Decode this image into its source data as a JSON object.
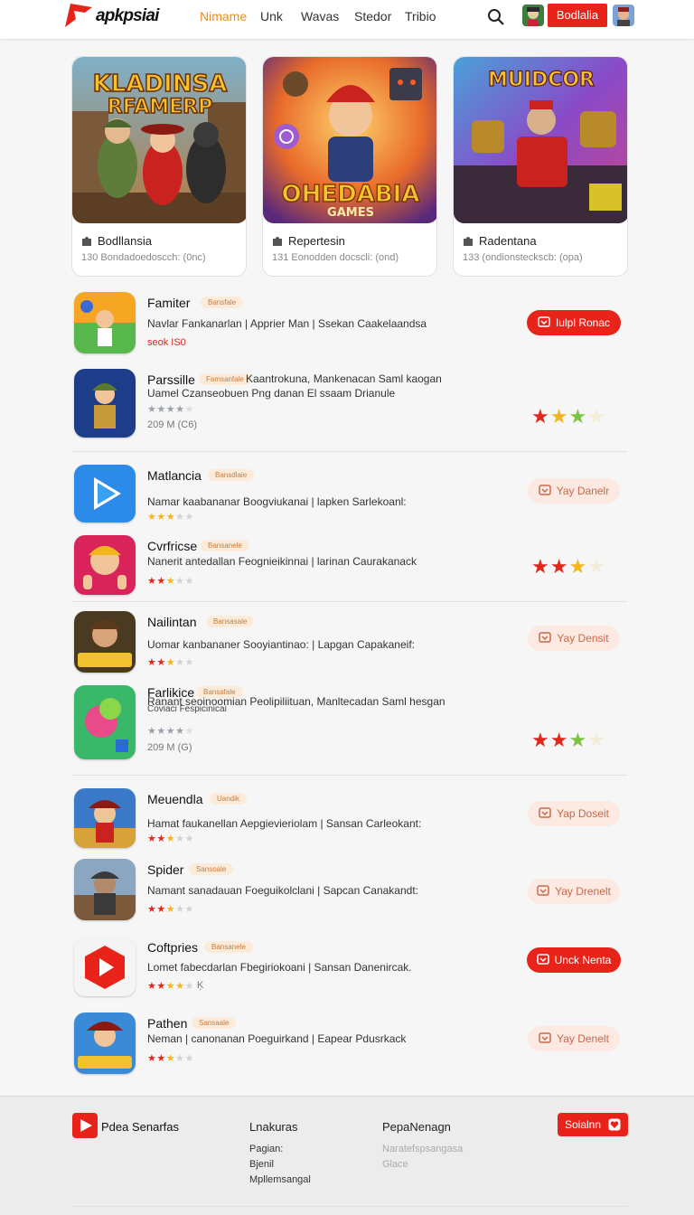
{
  "header": {
    "logo_text": "apkpsiai",
    "nav": [
      "Nimame",
      "Unk",
      "Wavas",
      "Stedor",
      "Tribio"
    ],
    "cta": "Bodlalia"
  },
  "featured": [
    {
      "title": "Bodllansia",
      "meta": "130  Bondadoedoscch: (0nc)",
      "art_text": [
        "KLADINSA",
        "RFAMERP"
      ]
    },
    {
      "title": "Repertesin",
      "meta": "131  Eonodden docscli: (ond)",
      "art_text": [
        "OHEDABIA",
        "GAMES"
      ]
    },
    {
      "title": "Radentana",
      "meta": "133  (ondionsteckscb: (opa)",
      "art_text": [
        "MUIDCOR"
      ]
    }
  ],
  "apps": [
    {
      "name": "Famiter",
      "tag": "Bansfale",
      "desc": "Navlar Fankanarlan | Apprier Man | Ssekan Caakelaandsa",
      "meta": "seok  IS0",
      "button": "Iulpl Ronac"
    },
    {
      "name": "Parssille",
      "tag": "Famsanfale",
      "desc": "Kaantrokuna, Mankenacan Saml kaogan",
      "desc2": "Uamel Czanseobuen Png danan El ssaam Drianule",
      "meta": "209 M (C6)",
      "stars": "★★★★★"
    },
    {
      "name": "Matlancia",
      "tag": "Bansdlaie",
      "desc": "Namar kaabananar Boogviukanai | lapken Sarlekoanl:",
      "button": "Yay Danelr"
    },
    {
      "name": "Cvrfricse",
      "tag": "Bansanele",
      "desc": "Nanerit antedallan Feognieikinnai | larinan Caurakanack",
      "stars": "★★★★★"
    },
    {
      "name": "Nailintan",
      "tag": "Bansasale",
      "desc": "Uomar kanbananer Sooyiantinao: | Lapgan Capakaneif:",
      "button": "Yay Densit"
    },
    {
      "name": "Farlikice",
      "tag": "Bansafale",
      "desc": "Ranant seoinoomian Peolipiliituan, Manltecadan Saml hesgan",
      "desc2": "Coviaci Fespicinicai",
      "meta": "209 M (G)",
      "stars": "★★★★★"
    },
    {
      "name": "Meuendla",
      "tag": "Uandik",
      "desc": "Hamat faukanellan Aepgievieriolam | Sansan Carleokant:",
      "button": "Yap Doseit"
    },
    {
      "name": "Spider",
      "tag": "Sansoale",
      "desc": "Namant sanadauan Foeguikolclani | Sapcan Canakandt:",
      "button": "Yay Drenelt"
    },
    {
      "name": "Coftpries",
      "tag": "Bansanele",
      "desc": "Lomet fabecdarlan Fbegiriokoani | Sansan Danenircak.",
      "meta": "Ķ",
      "button": "Unck Nenta"
    },
    {
      "name": "Pathen",
      "tag": "Sansaale",
      "desc": "Neman | canonanan Poeguirkand | Eapear Pdusrkack",
      "button": "Yay Denelt"
    }
  ],
  "footer": {
    "brand": "Pdea Senarfas",
    "col1_title": "Lnakuras",
    "col1_links": [
      "Pagian:",
      "Bjenil",
      "Mpllemsangal"
    ],
    "col2_title": "PepaNenagn",
    "col2_links": [
      "Naratefspsangasa",
      "Glace"
    ],
    "button": "Soialnn"
  },
  "colors": {
    "accent": "#e8241a",
    "nav_active": "#f08a1c",
    "star_red": "#e3261c",
    "star_yellow": "#f2b51d",
    "star_green": "#7cc243"
  }
}
